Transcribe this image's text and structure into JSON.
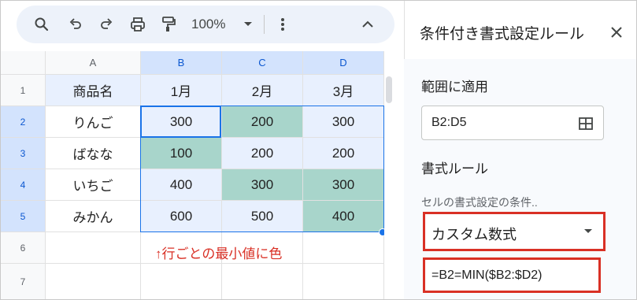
{
  "toolbar": {
    "zoom": "100%",
    "icons": [
      "search-icon",
      "undo-icon",
      "redo-icon",
      "print-icon",
      "paint-format-icon",
      "chevron-down-icon",
      "more-vert-icon",
      "chevron-up-icon"
    ]
  },
  "grid": {
    "columns": [
      "A",
      "B",
      "C",
      "D"
    ],
    "rows": [
      "1",
      "2",
      "3",
      "4",
      "5",
      "6",
      "7"
    ],
    "header_row": [
      "商品名",
      "1月",
      "2月",
      "3月"
    ],
    "data": [
      [
        "りんご",
        "300",
        "200",
        "300"
      ],
      [
        "ばなな",
        "100",
        "200",
        "200"
      ],
      [
        "いちご",
        "400",
        "300",
        "300"
      ],
      [
        "みかん",
        "600",
        "500",
        "400"
      ]
    ],
    "note": "↑行ごとの最小値に色",
    "highlight_color": "#a8d5cb"
  },
  "panel": {
    "title": "条件付き書式設定ルール",
    "apply_range_label": "範囲に適用",
    "range_value": "B2:D5",
    "format_rules_label": "書式ルール",
    "condition_label": "セルの書式設定の条件..",
    "condition_value": "カスタム数式",
    "formula_value": "=B2=MIN($B2:$D2)",
    "accent_color": "#d93025"
  }
}
